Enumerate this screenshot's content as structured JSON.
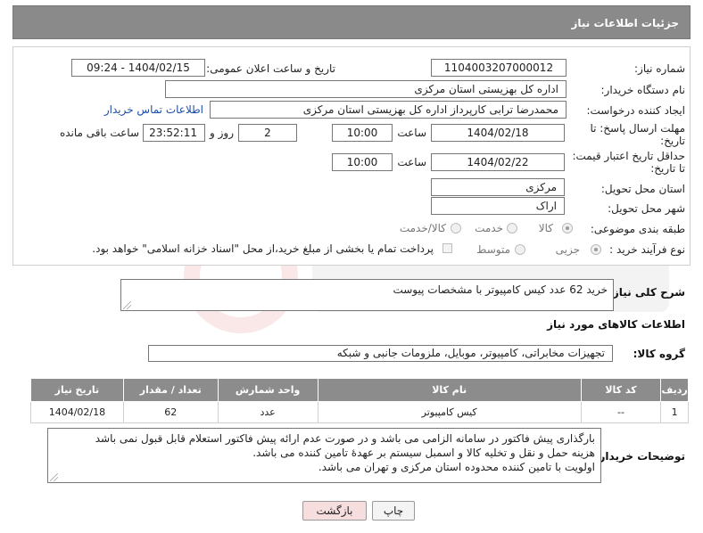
{
  "page": {
    "title": "جزئیات اطلاعات نیاز"
  },
  "form": {
    "need_number_label": "شماره نیاز:",
    "need_number": "1104003207000012",
    "announce_label": "تاریخ و ساعت اعلان عمومی:",
    "announce_value": "1404/02/15 - 09:24",
    "buyer_org_label": "نام دستگاه خریدار:",
    "buyer_org": "اداره کل بهزیستی استان مرکزی",
    "creator_label": "ایجاد کننده درخواست:",
    "creator": "محمدرضا ترابی کارپرداز اداره کل بهزیستی استان مرکزی",
    "contact_link": "اطلاعات تماس خریدار",
    "deadline_label": "مهلت ارسال پاسخ: تا",
    "deadline_label2": "تاریخ:",
    "deadline_date": "1404/02/18",
    "time_label": "ساعت",
    "deadline_time": "10:00",
    "days_value": "2",
    "days_label": "روز و",
    "remaining_time": "23:52:11",
    "remaining_label": "ساعت باقی مانده",
    "validity_label": "حداقل تاریخ اعتبار قیمت:",
    "validity_label2": "تا تاریخ:",
    "validity_date": "1404/02/22",
    "validity_time": "10:00",
    "province_label": "استان محل تحویل:",
    "province": "مرکزی",
    "city_label": "شهر محل تحویل:",
    "city": "اراک",
    "category_label": "طبقه بندی موضوعی:",
    "category_options": [
      "کالا",
      "خدمت",
      "کالا/خدمت"
    ],
    "process_label": "نوع فرآیند خرید :",
    "process_options": [
      "جزیی",
      "متوسط"
    ],
    "payment_note": "پرداخت تمام یا بخشی از مبلغ خرید،از محل \"اسناد خزانه اسلامی\" خواهد بود."
  },
  "description": {
    "label": "شرح کلی نیاز:",
    "value": "خرید 62 عدد کیس کامپیوتر با مشخصات پیوست"
  },
  "goods": {
    "section_title": "اطلاعات کالاهای مورد نیاز",
    "group_label": "گروه کالا:",
    "group_value": "تجهیزات مخابراتی، کامپیوتر، موبایل، ملزومات جانبی و شبکه",
    "headers": [
      "ردیف",
      "کد کالا",
      "نام کالا",
      "واحد شمارش",
      "تعداد / مقدار",
      "تاریخ نیاز"
    ],
    "rows": [
      [
        "1",
        "--",
        "کیس کامپیوتر",
        "عدد",
        "62",
        "1404/02/18"
      ]
    ]
  },
  "buyer_notes": {
    "label": "توضیحات خریدار:",
    "lines": [
      "بارگذاری پیش فاکتور در سامانه الزامی می باشد و در صورت عدم ارائه پیش فاکتور استعلام قابل قبول نمی باشد",
      "هزینه حمل و نقل و تخلیه کالا و اسمبل سیستم بر عهدۀ تامین کننده می باشد.",
      "اولویت با تامین کننده محدوده استان مرکزی و تهران می باشد."
    ]
  },
  "actions": {
    "print": "چاپ",
    "back": "بازگشت"
  },
  "colors": {
    "header_bg": "#8a8a8a",
    "link": "#1a4ea8",
    "back_btn_bg": "#f6dede"
  }
}
